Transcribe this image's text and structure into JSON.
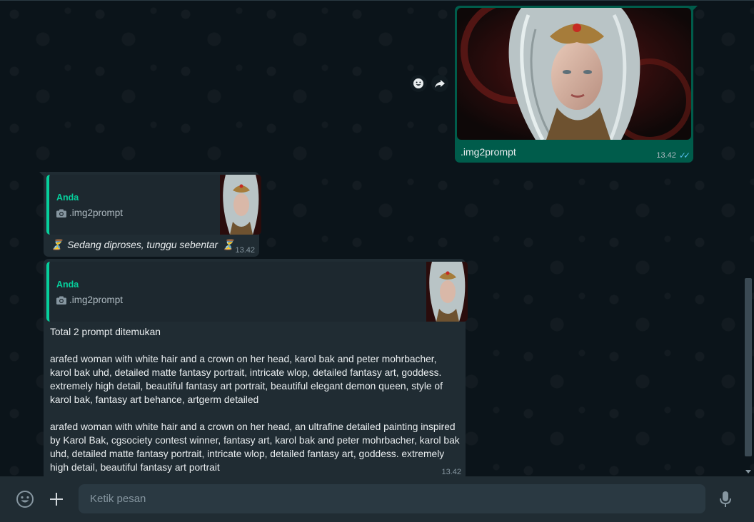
{
  "outgoing": {
    "caption": ".img2prompt",
    "time": "13.42",
    "status_icon": "double-check-read-icon"
  },
  "reply1": {
    "quote_author": "Anda",
    "quote_text": ".img2prompt",
    "hourglass_left": "⏳",
    "text": "Sedang diproses, tunggu sebentar",
    "hourglass_right": "⏳",
    "time": "13.42"
  },
  "reply2": {
    "quote_author": "Anda",
    "quote_text": ".img2prompt",
    "line1": "Total 2 prompt ditemukan",
    "prompt1": "arafed woman with white hair and a crown on her head, karol bak and peter mohrbacher, karol bak uhd, detailed matte fantasy portrait, intricate wlop, detailed fantasy art, goddess. extremely high detail, beautiful fantasy art portrait, beautiful elegant demon queen, style of karol bak, fantasy art behance, artgerm detailed",
    "prompt2": "arafed woman with white hair and a crown on her head, an ultrafine detailed painting inspired by Karol Bak, cgsociety contest winner, fantasy art, karol bak and peter mohrbacher, karol bak uhd, detailed matte fantasy portrait, intricate wlop, detailed fantasy art, goddess. extremely high detail, beautiful fantasy art portrait",
    "time": "13.42"
  },
  "composer": {
    "placeholder": "Ketik pesan"
  },
  "colors": {
    "accent": "#06cf9c",
    "outgoing_bg": "#005c4b",
    "incoming_bg": "#202c33",
    "read_ticks": "#53bdeb"
  }
}
